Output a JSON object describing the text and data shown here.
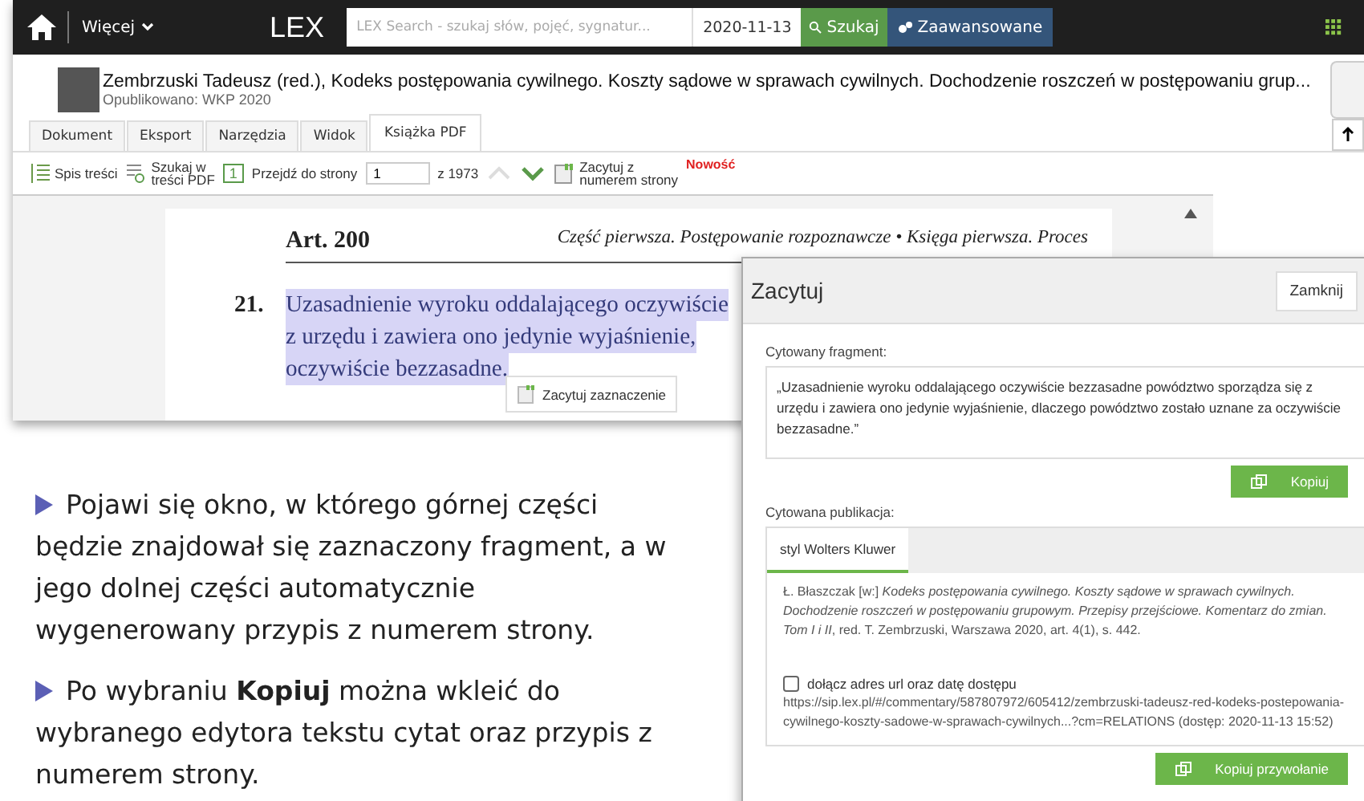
{
  "navbar": {
    "more_menu": "Więcej",
    "logo": "LEX",
    "search": {
      "placeholder": "LEX Search - szukaj słów, pojęć, sygnatur..."
    },
    "date": "2020-11-13",
    "search_button": "Szukaj",
    "advanced_button": "Zaawansowane"
  },
  "document": {
    "title": "Zembrzuski Tadeusz (red.), Kodeks postępowania cywilnego. Koszty sądowe w sprawach cywilnych. Dochodzenie roszczeń w postępowaniu grup...",
    "published": "Opublikowano: WKP 2020"
  },
  "tabs": [
    {
      "label": "Dokument",
      "selected": false
    },
    {
      "label": "Eksport",
      "selected": false
    },
    {
      "label": "Narzędzia",
      "selected": false
    },
    {
      "label": "Widok",
      "selected": false
    },
    {
      "label": "Książka PDF",
      "selected": true
    }
  ],
  "toolbar": {
    "toc": "Spis treści",
    "search_pdf": "Szukaj w treści PDF",
    "page_icon": "1",
    "goto": "Przejdź do strony",
    "page_value": "1",
    "page_total": "z 1973",
    "cite": "Zacytuj z numerem strony",
    "new_badge": "Nowość"
  },
  "pdf_page": {
    "article": "Art. 200",
    "running_head": "Część pierwsza. Postępowanie rozpoznawcze • Księga pierwsza. Proces",
    "paragraph_number": "21.",
    "lines": [
      "Uzasadnienie wyroku oddalającego oczywiście",
      "z urzędu i zawiera ono jedynie wyjaśnienie,",
      "oczywiście bezzasadne."
    ],
    "cite_selection": "Zacytuj zaznaczenie"
  },
  "dialog": {
    "title": "Zacytuj",
    "close_button": "Zamknij",
    "fragment_label": "Cytowany fragment:",
    "fragment": "„Uzasadnienie wyroku oddalającego oczywiście bezzasadne powództwo sporządza się z urzędu i zawiera ono jedynie wyjaśnienie, dlaczego powództwo zostało uznane za oczywiście bezzasadne.”",
    "copy_button": "Kopiuj",
    "publication_label": "Cytowana publikacja:",
    "style_tabs": [
      {
        "label": "styl Wolters Kluwer",
        "selected": true
      }
    ],
    "citation": "Ł. Błaszczak [w:] *Kodeks postępowania cywilnego. Koszty sądowe w sprawach cywilnych. Dochodzenie roszczeń w postępowaniu grupowym. Przepisy przejściowe. Komentarz do zmian. Tom I i II*, red. T. Zembrzuski, Warszawa 2020, art. 4(1), s. 442.",
    "include_url": {
      "label": "dołącz adres url oraz datę dostępu",
      "checked": false
    },
    "url": "https://sip.lex.pl/#/commentary/587807972/605412/zembrzuski-tadeusz-red-kodeks-postepowania-cywilnego-koszty-sadowe-w-sprawach-cywilnych...?cm=RELATIONS (dostęp: 2020-11-13 15:52)",
    "copy_reference_button": "Kopiuj przywołanie"
  },
  "instructions": [
    "Pojawi się okno, w którego górnej części będzie znajdował się zaznaczony fragment, a w jego dolnej części automatycznie wygenerowany przypis z numerem strony.",
    "Po wybraniu **Kopiuj** można wkleić do wybranego edytora tekstu cytat oraz przypis z numerem strony."
  ]
}
